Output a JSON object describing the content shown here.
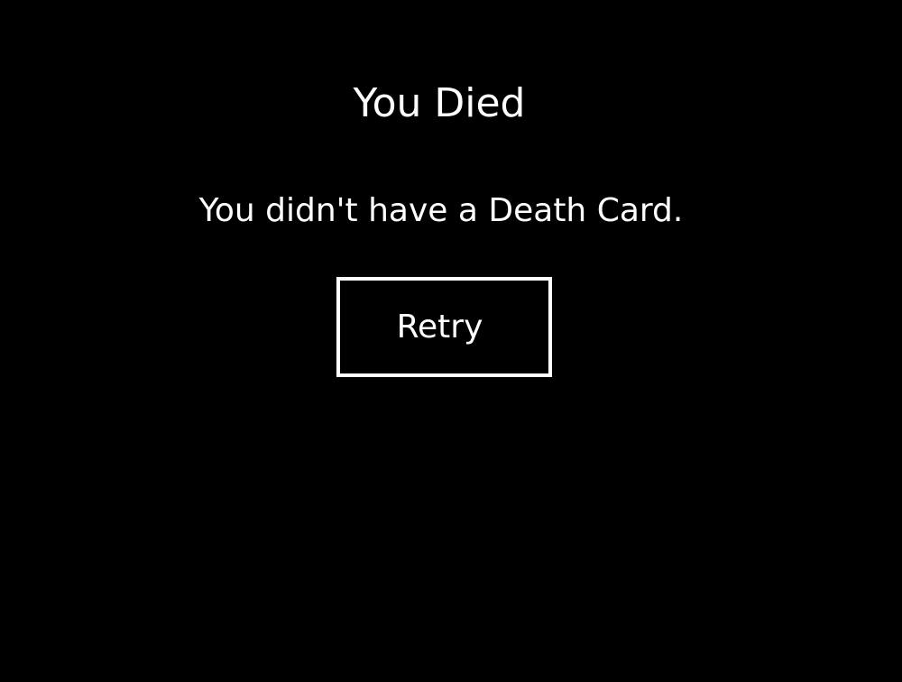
{
  "screen": {
    "title": "You Died",
    "message": "You didn't have a Death Card.",
    "retry_label": "Retry"
  },
  "colors": {
    "background": "#000000",
    "foreground": "#ffffff"
  }
}
